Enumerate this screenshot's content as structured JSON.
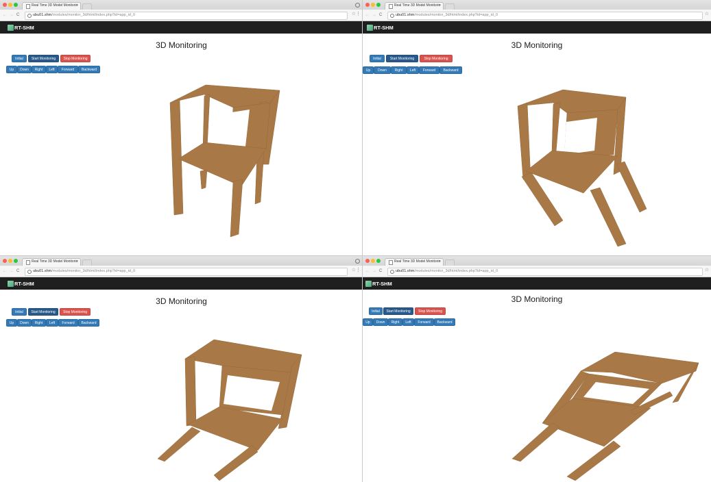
{
  "browser": {
    "tab_title": "Real Time 3D Model Monitorin",
    "tab_close": "×",
    "url_host": "ubu01.shm",
    "url_path": "/modules/monitor_3d/html/index.php?id=app_id_0",
    "nav_back": "←",
    "nav_forward": "→",
    "nav_reload": "C",
    "star": "☆",
    "menu": "⋮"
  },
  "app": {
    "brand": "RT-SHM",
    "page_title": "3D Monitoring"
  },
  "controls": {
    "initial": "Initial",
    "start_monitoring": "Start Monitoring",
    "stop_monitoring": "Stop Monitoring",
    "up": "Up",
    "down": "Down",
    "right": "Right",
    "left": "Left",
    "forward": "Forward",
    "backward": "Backward"
  },
  "colors": {
    "navbar": "#1f1f1f",
    "button_primary": "#337ab7",
    "button_active": "#28598a",
    "button_danger": "#d9534f",
    "model": "#a87847"
  },
  "panels": [
    {
      "id": "p0",
      "view": "view-1"
    },
    {
      "id": "p1",
      "view": "view-2"
    },
    {
      "id": "p2",
      "view": "view-3"
    },
    {
      "id": "p3",
      "view": "view-4"
    }
  ]
}
